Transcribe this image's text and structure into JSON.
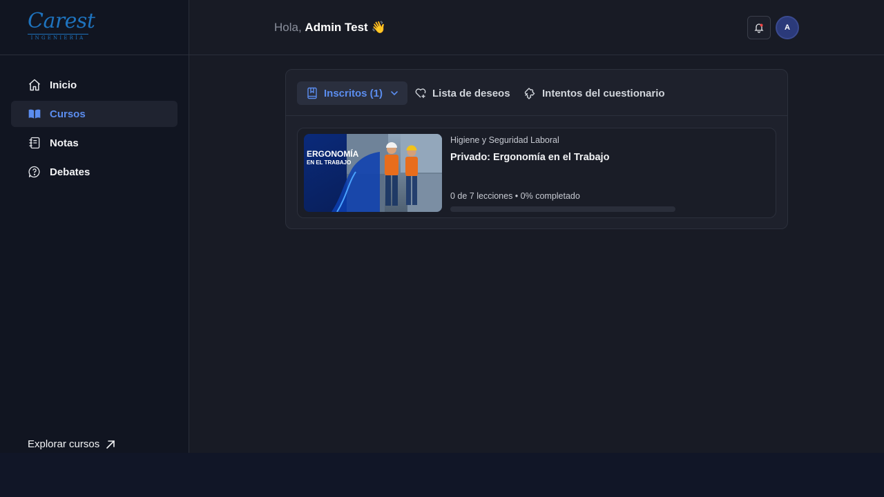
{
  "brand": {
    "logo_word": "Carest",
    "logo_sub": "INGENIERÍA",
    "color": "#1e73be"
  },
  "sidebar": {
    "items": [
      {
        "label": "Inicio",
        "icon": "home-icon",
        "active": false
      },
      {
        "label": "Cursos",
        "icon": "book-open-icon",
        "active": true
      },
      {
        "label": "Notas",
        "icon": "notes-icon",
        "active": false
      },
      {
        "label": "Debates",
        "icon": "question-bubble-icon",
        "active": false
      }
    ],
    "explore_label": "Explorar cursos"
  },
  "header": {
    "hola": "Hola,",
    "user_name": "Admin Test",
    "wave": "👋",
    "avatar_initial": "A"
  },
  "tabs": {
    "enrolled": "Inscritos (1)",
    "wishlist": "Lista de deseos",
    "quiz_attempts": "Intentos del cuestionario"
  },
  "course": {
    "category": "Higiene y Seguridad Laboral",
    "title": "Privado: Ergonomía en el Trabajo",
    "progress_text": "0 de 7 lecciones • 0% completado",
    "progress_fraction": 0,
    "thumb_title_1": "ERGONOMÍA",
    "thumb_title_2": "EN EL TRABAJO"
  },
  "colors": {
    "accent": "#5b8def",
    "sidebar_bg": "#111521",
    "panel_bg": "#1e212c",
    "bell_dot": "#ef4444"
  }
}
